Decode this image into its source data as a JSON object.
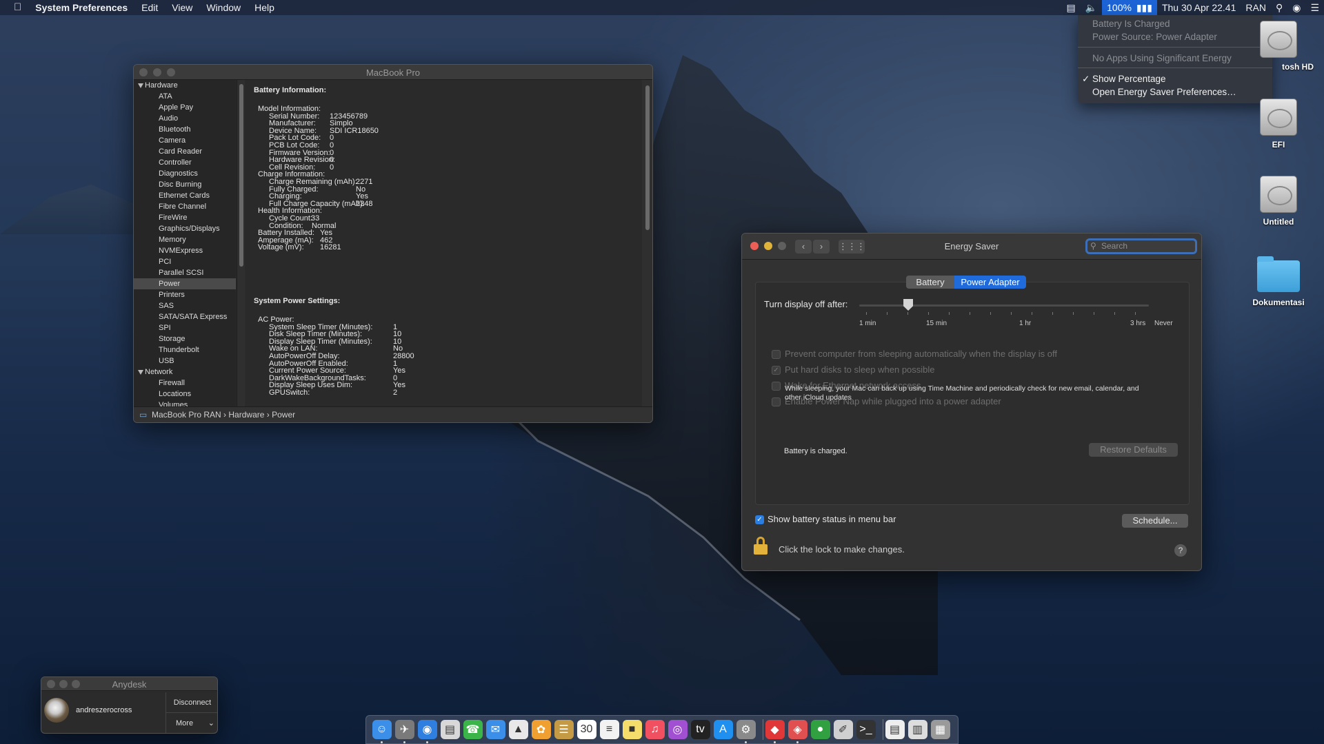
{
  "menubar": {
    "app_name": "System Preferences",
    "menus": [
      "Edit",
      "View",
      "Window",
      "Help"
    ],
    "battery_percent": "100%",
    "datetime": "Thu 30 Apr  22.41",
    "user": "RAN"
  },
  "battery_menu": {
    "status": "Battery Is Charged",
    "source": "Power Source: Power Adapter",
    "apps": "No Apps Using Significant Energy",
    "show_percentage": "Show Percentage",
    "open_prefs": "Open Energy Saver Preferences…"
  },
  "sysinfo": {
    "title": "MacBook Pro",
    "sidebar": [
      {
        "label": "Hardware",
        "section": true
      },
      {
        "label": "ATA"
      },
      {
        "label": "Apple Pay"
      },
      {
        "label": "Audio"
      },
      {
        "label": "Bluetooth"
      },
      {
        "label": "Camera"
      },
      {
        "label": "Card Reader"
      },
      {
        "label": "Controller"
      },
      {
        "label": "Diagnostics"
      },
      {
        "label": "Disc Burning"
      },
      {
        "label": "Ethernet Cards"
      },
      {
        "label": "Fibre Channel"
      },
      {
        "label": "FireWire"
      },
      {
        "label": "Graphics/Displays"
      },
      {
        "label": "Memory"
      },
      {
        "label": "NVMExpress"
      },
      {
        "label": "PCI"
      },
      {
        "label": "Parallel SCSI"
      },
      {
        "label": "Power",
        "selected": true
      },
      {
        "label": "Printers"
      },
      {
        "label": "SAS"
      },
      {
        "label": "SATA/SATA Express"
      },
      {
        "label": "SPI"
      },
      {
        "label": "Storage"
      },
      {
        "label": "Thunderbolt"
      },
      {
        "label": "USB"
      },
      {
        "label": "Network",
        "section": true
      },
      {
        "label": "Firewall"
      },
      {
        "label": "Locations"
      },
      {
        "label": "Volumes"
      }
    ],
    "battery_heading": "Battery Information:",
    "model_heading": "Model Information:",
    "model": [
      [
        "Serial Number:",
        "123456789"
      ],
      [
        "Manufacturer:",
        "Simplo"
      ],
      [
        "Device Name:",
        "SDI ICR18650"
      ],
      [
        "Pack Lot Code:",
        "0"
      ],
      [
        "PCB Lot Code:",
        "0"
      ],
      [
        "Firmware Version:",
        "0"
      ],
      [
        "Hardware Revision:",
        "0"
      ],
      [
        "Cell Revision:",
        "0"
      ]
    ],
    "charge_heading": "Charge Information:",
    "charge": [
      [
        "Charge Remaining (mAh):",
        "2271"
      ],
      [
        "Fully Charged:",
        "No"
      ],
      [
        "Charging:",
        "Yes"
      ],
      [
        "Full Charge Capacity (mAh):",
        "2348"
      ]
    ],
    "health_heading": "Health Information:",
    "health": [
      [
        "Cycle Count:",
        "33"
      ],
      [
        "Condition:",
        "Normal"
      ]
    ],
    "misc": [
      [
        "Battery Installed:",
        "Yes"
      ],
      [
        "Amperage (mA):",
        "462"
      ],
      [
        "Voltage (mV):",
        "16281"
      ]
    ],
    "power_heading": "System Power Settings:",
    "ac_heading": "AC Power:",
    "ac": [
      [
        "System Sleep Timer (Minutes):",
        "1"
      ],
      [
        "Disk Sleep Timer (Minutes):",
        "10"
      ],
      [
        "Display Sleep Timer (Minutes):",
        "10"
      ],
      [
        "Wake on LAN:",
        "No"
      ],
      [
        "AutoPowerOff Delay:",
        "28800"
      ],
      [
        "AutoPowerOff Enabled:",
        "1"
      ],
      [
        "Current Power Source:",
        "Yes"
      ],
      [
        "DarkWakeBackgroundTasks:",
        "0"
      ],
      [
        "Display Sleep Uses Dim:",
        "Yes"
      ],
      [
        "GPUSwitch:",
        "2"
      ]
    ],
    "path": [
      "MacBook Pro RAN",
      "Hardware",
      "Power"
    ]
  },
  "energy": {
    "title": "Energy Saver",
    "search_placeholder": "Search",
    "tabs": [
      "Battery",
      "Power Adapter"
    ],
    "active_tab": "Power Adapter",
    "slider_label": "Turn display off after:",
    "slider_value_minutes": 10,
    "ticks": [
      "1 min",
      "15 min",
      "1 hr",
      "3 hrs",
      "Never"
    ],
    "options": [
      {
        "label": "Prevent computer from sleeping automatically when the display is off",
        "checked": false
      },
      {
        "label": "Put hard disks to sleep when possible",
        "checked": true
      },
      {
        "label": "Wake for Ethernet network access",
        "checked": false
      },
      {
        "label": "Enable Power Nap while plugged into a power adapter",
        "checked": false
      }
    ],
    "powernap_desc": "While sleeping, your Mac can back up using Time Machine and periodically check for new email, calendar, and other iCloud updates",
    "battery_status": "Battery is charged.",
    "restore_defaults": "Restore Defaults",
    "show_battery": "Show battery status in menu bar",
    "schedule": "Schedule...",
    "lock_text": "Click the lock to make changes.",
    "help": "?"
  },
  "desktop_icons": [
    "tosh HD",
    "EFI",
    "Untitled",
    "Dokumentasi"
  ],
  "anydesk": {
    "title": "Anydesk",
    "user": "andreszerocross",
    "disconnect": "Disconnect",
    "more": "More"
  },
  "dock": [
    "Finder",
    "Launchpad",
    "Safari",
    "Preview",
    "FaceTime",
    "Messages",
    "Maps",
    "Photos",
    "Notes",
    "Calendar",
    "Reminders",
    "Stickies",
    "Music",
    "Podcasts",
    "TV",
    "App Store",
    "System Preferences",
    "Anydesk",
    "Remote",
    "Activity",
    "Script Editor",
    "Terminal",
    "TextEdit",
    "Preview File",
    "Trash"
  ],
  "colors": {
    "accent": "#1c64d6",
    "checkbox": "#2a7de1"
  }
}
